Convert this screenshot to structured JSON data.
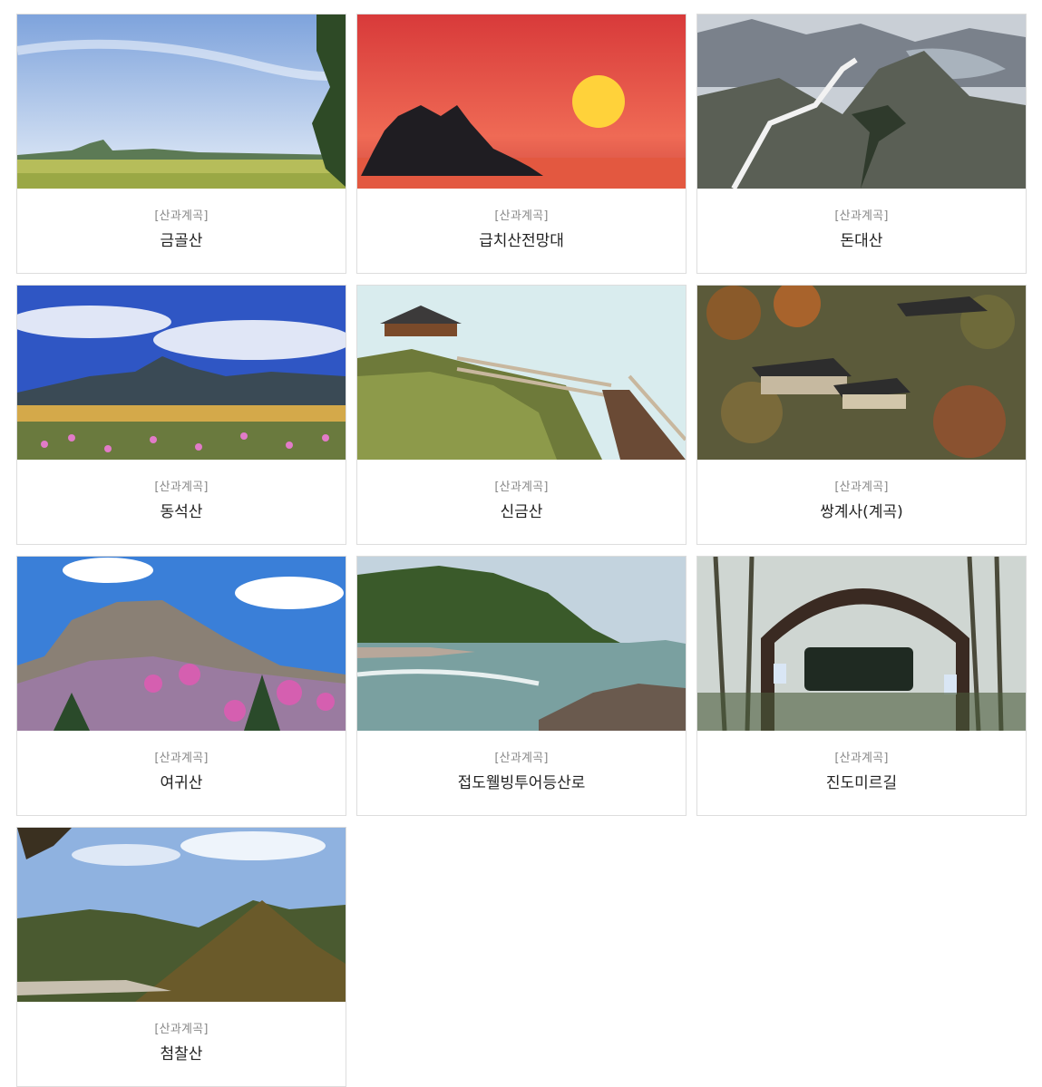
{
  "cards": [
    {
      "category": "[산과계곡]",
      "title": "금골산",
      "image": "mountain-field-photo"
    },
    {
      "category": "[산과계곡]",
      "title": "급치산전망대",
      "image": "sunset-sea-photo"
    },
    {
      "category": "[산과계곡]",
      "title": "돈대산",
      "image": "snowy-ridge-photo"
    },
    {
      "category": "[산과계곡]",
      "title": "동석산",
      "image": "mountain-flowers-photo"
    },
    {
      "category": "[산과계곡]",
      "title": "신금산",
      "image": "pavilion-stairs-photo"
    },
    {
      "category": "[산과계곡]",
      "title": "쌍계사(계곡)",
      "image": "temple-autumn-photo"
    },
    {
      "category": "[산과계곡]",
      "title": "여귀산",
      "image": "azalea-peak-photo"
    },
    {
      "category": "[산과계곡]",
      "title": "접도웰빙투어등산로",
      "image": "coast-rocks-photo"
    },
    {
      "category": "[산과계곡]",
      "title": "진도미르길",
      "image": "trail-gate-photo"
    },
    {
      "category": "[산과계곡]",
      "title": "첨찰산",
      "image": "green-hills-photo"
    }
  ]
}
